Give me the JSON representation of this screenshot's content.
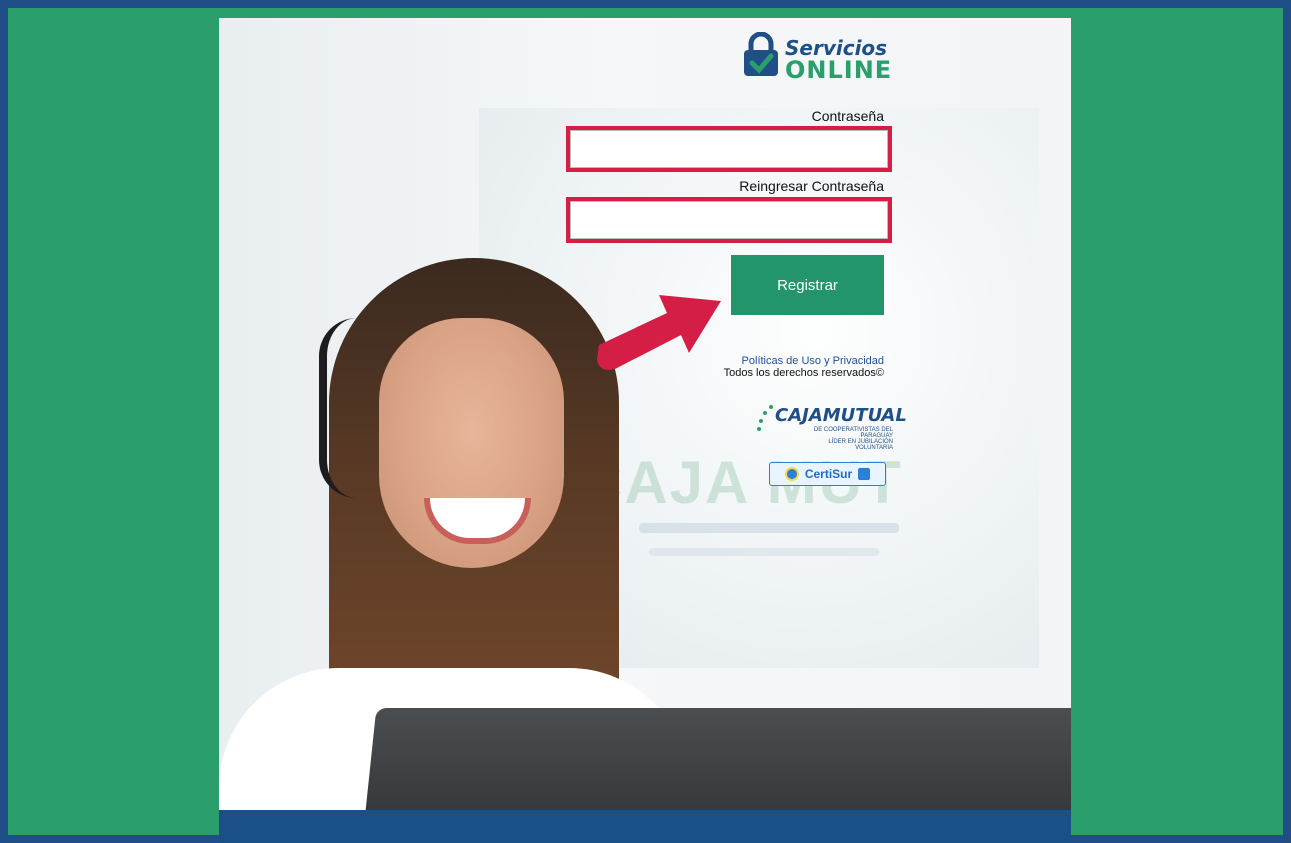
{
  "brand": {
    "logo_line1": "Servicios",
    "logo_line2": "ONLINE"
  },
  "form": {
    "password_label": "Contraseña",
    "password_value": "",
    "password_placeholder": "",
    "repeat_label": "Reingresar Contraseña",
    "repeat_value": "",
    "repeat_placeholder": "",
    "submit_label": "Registrar"
  },
  "footer": {
    "policy_link": "Políticas de Uso y Privacidad",
    "rights_text": "Todos los derechos reservados©"
  },
  "partners": {
    "caja_name": "CAJAMUTUAL",
    "caja_tagline": "DE COOPERATIVISTAS DEL PARAGUAY",
    "caja_sub": "LÍDER EN JUBILACIÓN VOLUNTARIA",
    "certisur_label": "CertiSur"
  },
  "background": {
    "sign_text": "CAJA MUT"
  },
  "colors": {
    "frame": "#2a9f6b",
    "border": "#1f4f86",
    "field_highlight": "#d41e45",
    "button": "#23956b",
    "arrow": "#d41e45"
  },
  "icons": {
    "logo": "lock-check-icon",
    "arrow": "arrow-right-icon",
    "certisur": "certisur-badge-icon"
  }
}
